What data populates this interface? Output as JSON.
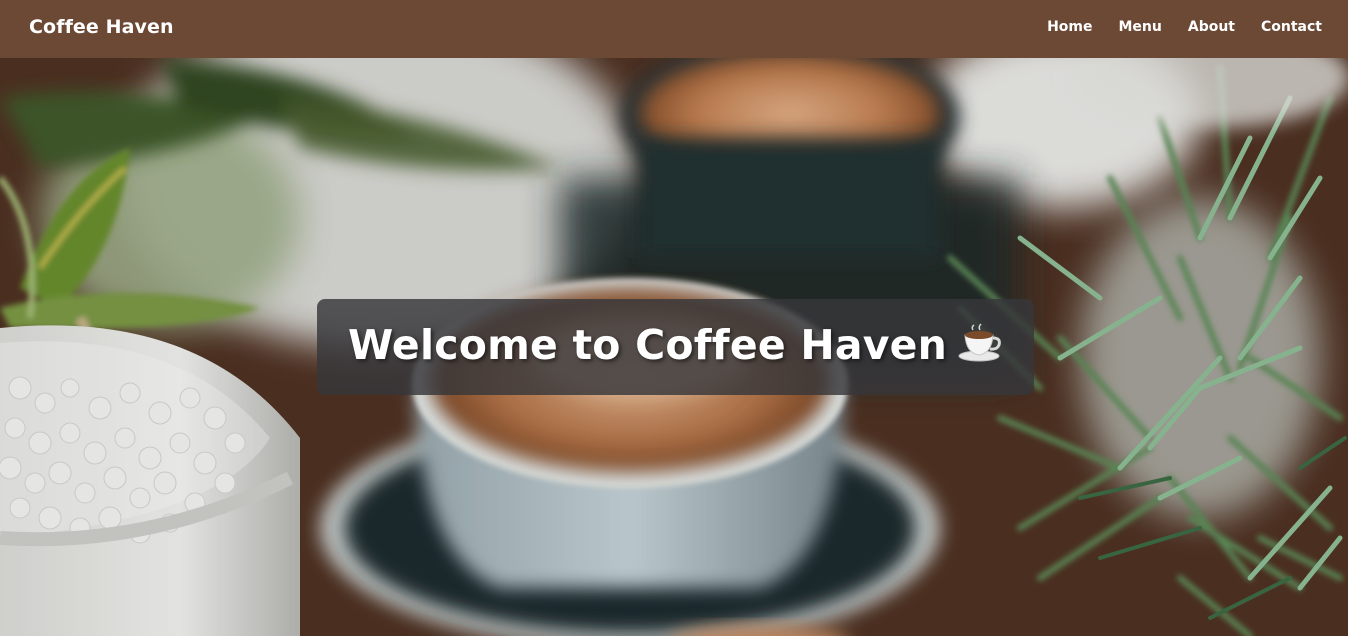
{
  "navbar": {
    "brand": "Coffee Haven",
    "links": [
      "Home",
      "Menu",
      "About",
      "Contact"
    ]
  },
  "hero": {
    "title": "Welcome to Coffee Haven",
    "icon": "coffee-cup-icon"
  },
  "colors": {
    "navbar_bg": "#6b4935",
    "text": "#ffffff",
    "title_box_bg": "#37373a"
  }
}
